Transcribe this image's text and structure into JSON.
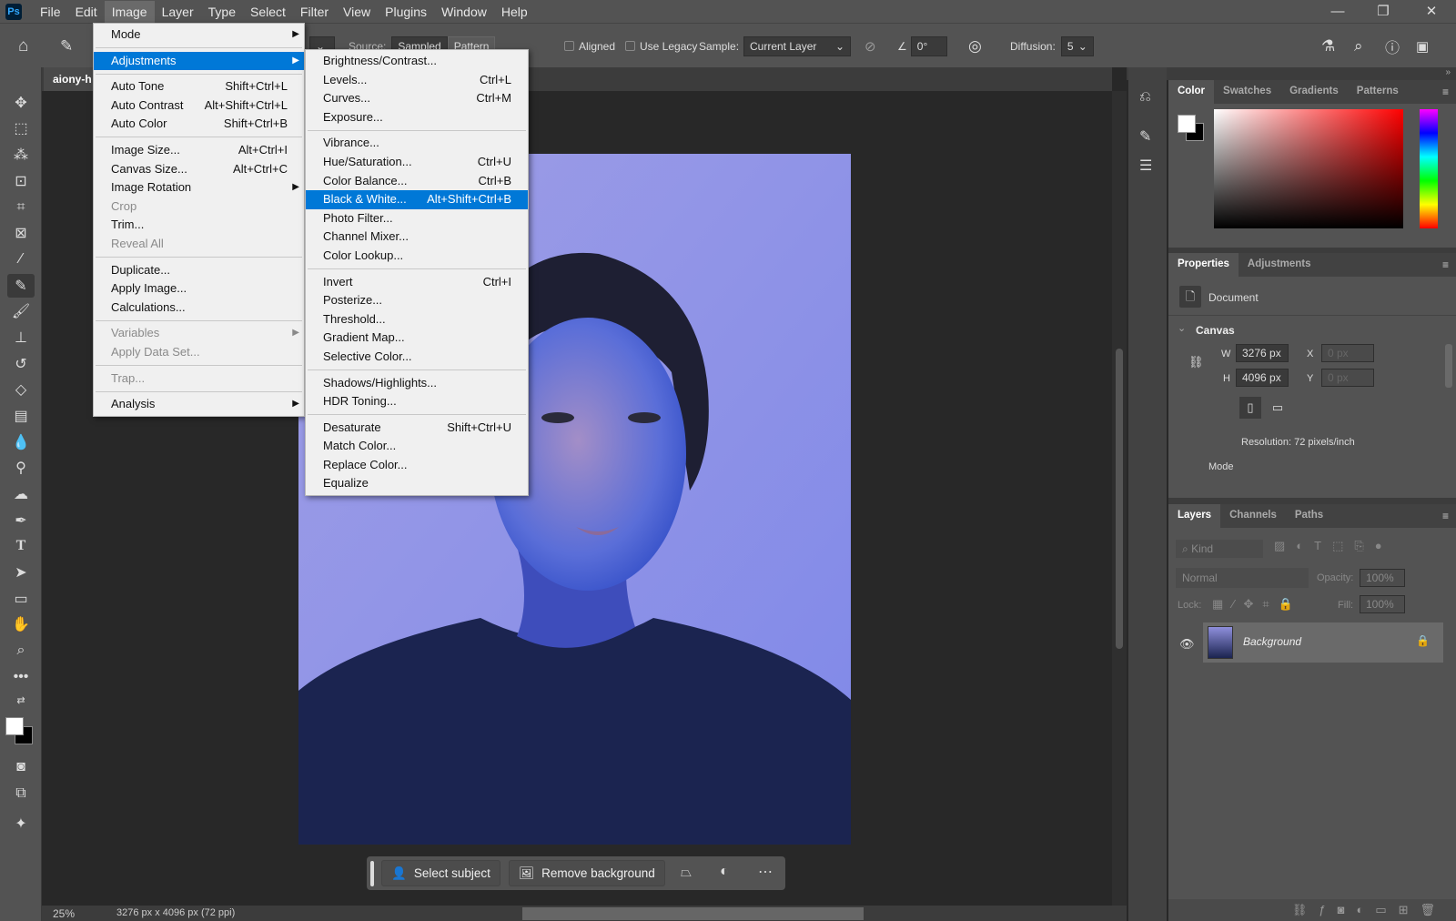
{
  "menubar": {
    "logo": "Ps",
    "items": [
      "File",
      "Edit",
      "Image",
      "Layer",
      "Type",
      "Select",
      "Filter",
      "View",
      "Plugins",
      "Window",
      "Help"
    ],
    "active": "Image"
  },
  "window_controls": {
    "minimize": "—",
    "restore": "❐",
    "close": "✕"
  },
  "options_bar": {
    "source_label": "Source:",
    "source_options": [
      "Sampled",
      "Pattern"
    ],
    "source_selected": "Sampled",
    "aligned_label": "Aligned",
    "use_legacy_label": "Use Legacy",
    "sample_label": "Sample:",
    "sample_value": "Current Layer",
    "angle_value": "0°",
    "diffusion_label": "Diffusion:",
    "diffusion_value": "5"
  },
  "document_tab": {
    "title": "aiony-h"
  },
  "image_menu": [
    {
      "label": "Mode",
      "submenu": true
    },
    {
      "sep": true
    },
    {
      "label": "Adjustments",
      "submenu": true,
      "highlighted": true
    },
    {
      "sep": true
    },
    {
      "label": "Auto Tone",
      "shortcut": "Shift+Ctrl+L"
    },
    {
      "label": "Auto Contrast",
      "shortcut": "Alt+Shift+Ctrl+L"
    },
    {
      "label": "Auto Color",
      "shortcut": "Shift+Ctrl+B"
    },
    {
      "sep": true
    },
    {
      "label": "Image Size...",
      "shortcut": "Alt+Ctrl+I"
    },
    {
      "label": "Canvas Size...",
      "shortcut": "Alt+Ctrl+C"
    },
    {
      "label": "Image Rotation",
      "submenu": true
    },
    {
      "label": "Crop",
      "disabled": true
    },
    {
      "label": "Trim..."
    },
    {
      "label": "Reveal All",
      "disabled": true
    },
    {
      "sep": true
    },
    {
      "label": "Duplicate..."
    },
    {
      "label": "Apply Image..."
    },
    {
      "label": "Calculations..."
    },
    {
      "sep": true
    },
    {
      "label": "Variables",
      "submenu": true,
      "disabled": true
    },
    {
      "label": "Apply Data Set...",
      "disabled": true
    },
    {
      "sep": true
    },
    {
      "label": "Trap...",
      "disabled": true
    },
    {
      "sep": true
    },
    {
      "label": "Analysis",
      "submenu": true
    }
  ],
  "adjustments_menu": [
    {
      "label": "Brightness/Contrast..."
    },
    {
      "label": "Levels...",
      "shortcut": "Ctrl+L"
    },
    {
      "label": "Curves...",
      "shortcut": "Ctrl+M"
    },
    {
      "label": "Exposure..."
    },
    {
      "sep": true
    },
    {
      "label": "Vibrance..."
    },
    {
      "label": "Hue/Saturation...",
      "shortcut": "Ctrl+U"
    },
    {
      "label": "Color Balance...",
      "shortcut": "Ctrl+B"
    },
    {
      "label": "Black & White...",
      "shortcut": "Alt+Shift+Ctrl+B",
      "highlighted": true
    },
    {
      "label": "Photo Filter..."
    },
    {
      "label": "Channel Mixer..."
    },
    {
      "label": "Color Lookup..."
    },
    {
      "sep": true
    },
    {
      "label": "Invert",
      "shortcut": "Ctrl+I"
    },
    {
      "label": "Posterize..."
    },
    {
      "label": "Threshold..."
    },
    {
      "label": "Gradient Map..."
    },
    {
      "label": "Selective Color..."
    },
    {
      "sep": true
    },
    {
      "label": "Shadows/Highlights..."
    },
    {
      "label": "HDR Toning..."
    },
    {
      "sep": true
    },
    {
      "label": "Desaturate",
      "shortcut": "Shift+Ctrl+U"
    },
    {
      "label": "Match Color..."
    },
    {
      "label": "Replace Color..."
    },
    {
      "label": "Equalize"
    }
  ],
  "contextual_taskbar": {
    "select_subject": "Select subject",
    "remove_background": "Remove background"
  },
  "status": {
    "zoom": "25%",
    "doc_info": "3276 px x 4096 px (72 ppi)"
  },
  "color_panel": {
    "tabs": [
      "Color",
      "Swatches",
      "Gradients",
      "Patterns"
    ],
    "active": "Color",
    "foreground": "#ffffff",
    "background": "#000000",
    "hue_base": "#ff0000"
  },
  "properties_panel": {
    "tabs": [
      "Properties",
      "Adjustments"
    ],
    "active": "Properties",
    "doc_label": "Document",
    "section": "Canvas",
    "w_label": "W",
    "w_value": "3276 px",
    "h_label": "H",
    "h_value": "4096 px",
    "x_label": "X",
    "x_placeholder": "0 px",
    "y_label": "Y",
    "y_placeholder": "0 px",
    "resolution": "Resolution: 72 pixels/inch",
    "mode_label": "Mode"
  },
  "layers_panel": {
    "tabs": [
      "Layers",
      "Channels",
      "Paths"
    ],
    "active": "Layers",
    "filter_placeholder": "Kind",
    "blend_mode": "Normal",
    "opacity_label": "Opacity:",
    "opacity_value": "100%",
    "lock_label": "Lock:",
    "fill_label": "Fill:",
    "fill_value": "100%",
    "layers": [
      {
        "name": "Background",
        "visible": true,
        "locked": true
      }
    ]
  },
  "colors": {
    "accent": "#0078d7",
    "menu_bg": "#f0f0f0",
    "ui_panel": "#535353",
    "canvas_bg": "#282828"
  }
}
